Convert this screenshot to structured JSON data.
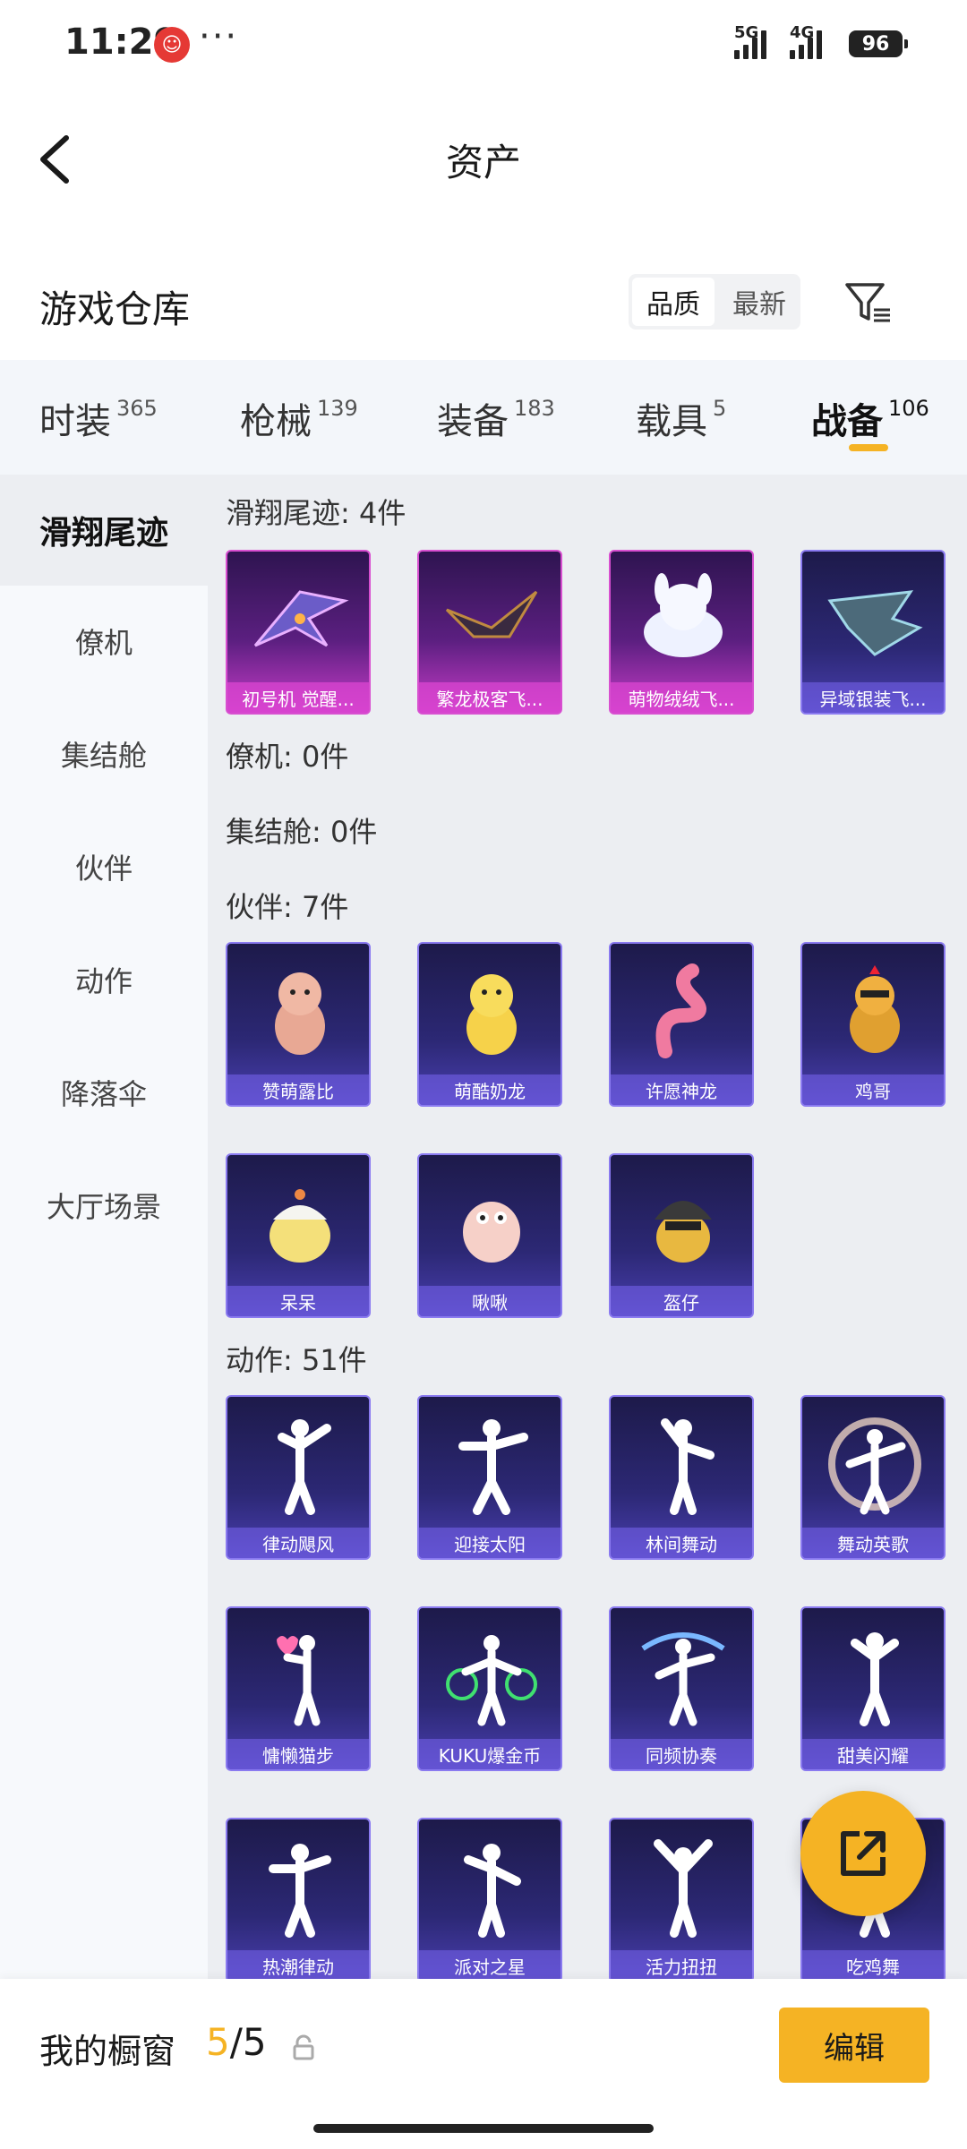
{
  "status": {
    "time": "11:29",
    "more": "···",
    "net1": "5G",
    "net2": "4G",
    "battery": "96"
  },
  "header": {
    "title": "资产"
  },
  "warehouse": {
    "title": "游戏仓库",
    "sort_quality": "品质",
    "sort_newest": "最新"
  },
  "categories": [
    {
      "name": "时装",
      "count": "365"
    },
    {
      "name": "枪械",
      "count": "139"
    },
    {
      "name": "装备",
      "count": "183"
    },
    {
      "name": "载具",
      "count": "5"
    },
    {
      "name": "战备",
      "count": "106"
    }
  ],
  "active_category": "战备",
  "sidebar": [
    "滑翔尾迹",
    "僚机",
    "集结舱",
    "伙伴",
    "动作",
    "降落伞",
    "大厅场景"
  ],
  "groups": {
    "glide": {
      "title": "滑翔尾迹: 4件",
      "items": [
        "初号机 觉醒...",
        "繁龙极客飞...",
        "萌物绒绒飞...",
        "异域银装飞..."
      ]
    },
    "wingman": {
      "title": "僚机: 0件"
    },
    "pod": {
      "title": "集结舱: 0件"
    },
    "partner": {
      "title": "伙伴: 7件",
      "items": [
        "赞萌露比",
        "萌酷奶龙",
        "许愿神龙",
        "鸡哥",
        "呆呆",
        "啾啾",
        "盔仔"
      ]
    },
    "emote": {
      "title": "动作: 51件",
      "items": [
        "律动飓风",
        "迎接太阳",
        "林间舞动",
        "舞动英歌",
        "慵懒猫步",
        "KUKU爆金币",
        "同频协奏",
        "甜美闪耀",
        "热潮律动",
        "派对之星",
        "活力扭扭",
        "吃鸡舞"
      ]
    }
  },
  "bottom": {
    "showcase_label": "我的橱窗",
    "current": "5",
    "separator": "/",
    "max": "5",
    "edit_label": "编辑"
  },
  "colors": {
    "accent": "#f5b324",
    "card_purple": "#2c2875",
    "card_pink": "#c83cc8"
  }
}
